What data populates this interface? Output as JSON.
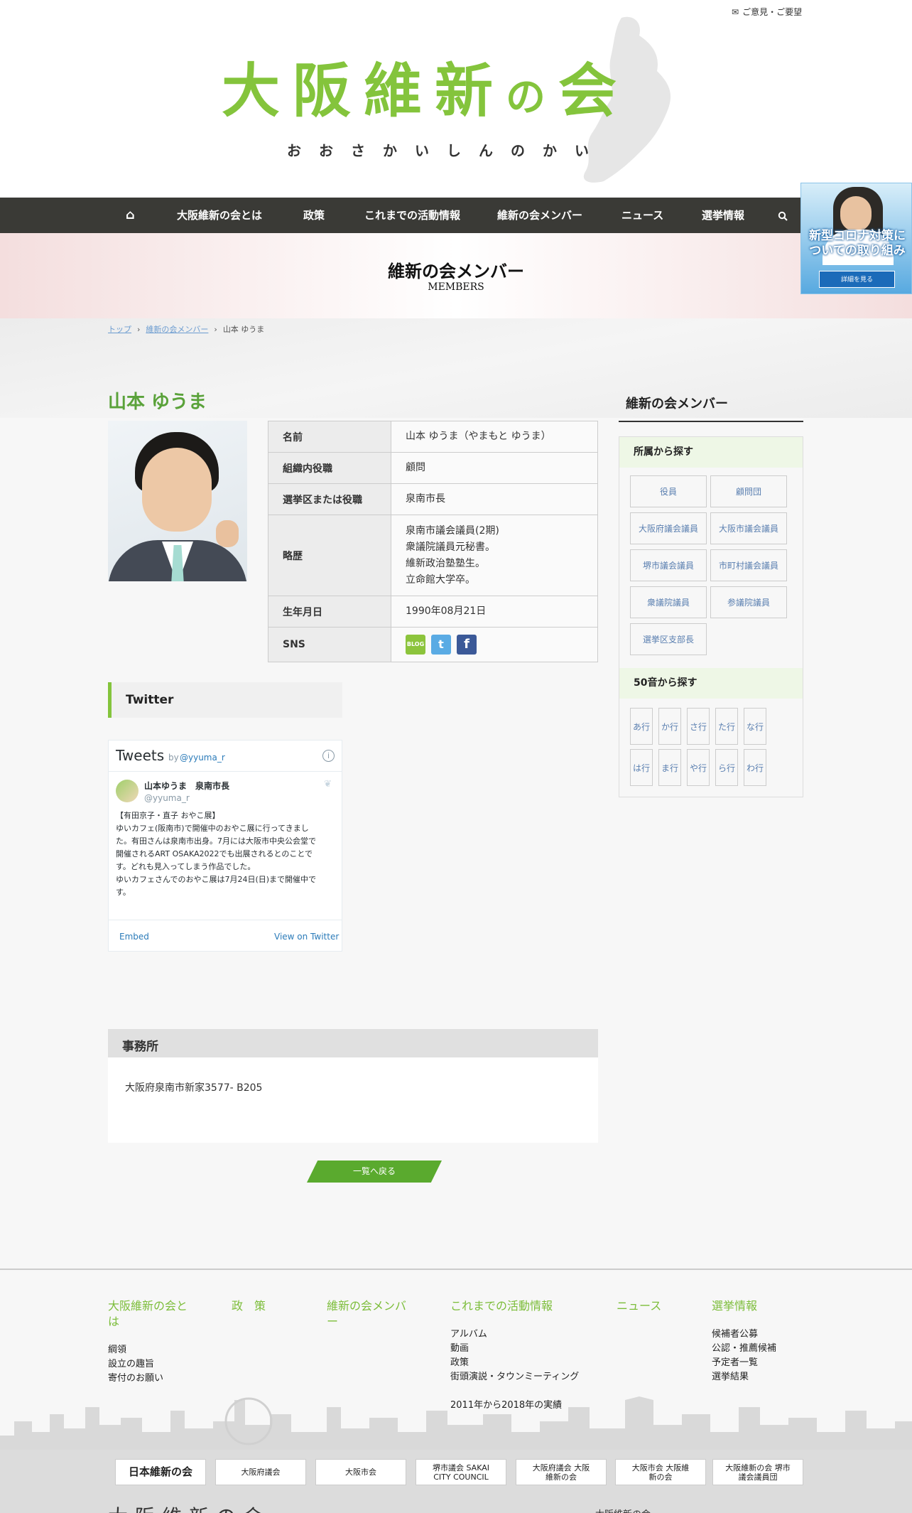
{
  "topbar": {
    "feedback_label": "ご意見・ご要望"
  },
  "logo": {
    "main_a": "大阪維新",
    "main_b": "の",
    "main_c": "会",
    "sub": "おおさかいしんのかい"
  },
  "nav": {
    "items": [
      "大阪維新の会とは",
      "政策",
      "これまでの活動情報",
      "維新の会メンバー",
      "ニュース",
      "選挙情報"
    ]
  },
  "banner": {
    "line1": "新型コロナ対策に",
    "line2": "ついての取り組み",
    "button": "詳細を見る"
  },
  "hero": {
    "title": "維新の会メンバー",
    "subtitle": "MEMBERS"
  },
  "breadcrumb": {
    "home": "トップ",
    "section": "維新の会メンバー",
    "current": "山本 ゆうま"
  },
  "member": {
    "name": "山本 ゆうま",
    "rows": [
      {
        "label": "名前",
        "value": "山本 ゆうま（やまもと ゆうま）"
      },
      {
        "label": "組織内役職",
        "value": "顧問"
      },
      {
        "label": "選挙区または役職",
        "value": "泉南市長"
      }
    ],
    "career_label": "略歴",
    "career": [
      "泉南市議会議員(2期)",
      "衆議院議員元秘書。",
      "維新政治塾塾生。",
      "立命館大学卒。"
    ],
    "birth_label": "生年月日",
    "birth": "1990年08月21日",
    "sns_label": "SNS",
    "sns": {
      "blog": "BLOG",
      "twitter": "t",
      "facebook": "f"
    }
  },
  "twitter": {
    "heading": "Twitter",
    "widget_title": "Tweets",
    "by": "by",
    "handle": "@yyuma_r",
    "author": "山本ゆうま　泉南市長",
    "author_handle": "@yyuma_r",
    "text": [
      "【有田京子・直子 おやこ展】",
      "ゆいカフェ(阪南市)で開催中のおやこ展に行ってきまし",
      "た。有田さんは泉南市出身。7月には大阪市中央公会堂で",
      "開催されるART OSAKA2022でも出展されるとのことで",
      "す。どれも見入ってしまう作品でした。",
      "ゆいカフェさんでのおやこ展は7月24日(日)まで開催中で",
      "す。"
    ],
    "embed": "Embed",
    "view": "View on Twitter"
  },
  "office": {
    "heading": "事務所",
    "address": "大阪府泉南市新家3577- B205"
  },
  "back_button": "一覧へ戻る",
  "sidebar": {
    "title": "維新の会メンバー",
    "affiliation_title": "所属から探す",
    "affiliations": [
      "役員",
      "顧問団",
      "大阪府議会議員",
      "大阪市議会議員",
      "堺市議会議員",
      "市町村議会議員",
      "衆議院議員",
      "参議院議員",
      "選挙区支部長"
    ],
    "kana_title": "50音から探す",
    "kana": [
      "あ行",
      "か行",
      "さ行",
      "た行",
      "な行",
      "は行",
      "ま行",
      "や行",
      "ら行",
      "わ行"
    ]
  },
  "footer": {
    "cols": [
      {
        "title": "大阪維新の会とは",
        "links": [
          "綱領",
          "設立の趣旨",
          "寄付のお願い"
        ]
      },
      {
        "title": "政　策",
        "links": []
      },
      {
        "title": "維新の会メンバー",
        "links": []
      },
      {
        "title": "これまでの活動情報",
        "links": [
          "アルバム",
          "動画",
          "政策",
          "街頭演説・タウンミーティング",
          "2011年から2018年の実績"
        ]
      },
      {
        "title": "ニュース",
        "links": []
      },
      {
        "title": "選挙情報",
        "links": [
          "候補者公募",
          "公認・推薦候補",
          "予定者一覧",
          "選挙結果"
        ]
      }
    ],
    "partners": [
      "日本維新の会",
      "大阪府議会",
      "大阪市会",
      "堺市議会 SAKAI CITY COUNCIL",
      "大阪府議会 大阪維新の会",
      "大阪市会 大阪維新の会",
      "大阪維新の会 堺市議会議員団"
    ],
    "bottom_logo": "大阪維新の会",
    "bottom_right": "大阪維新の会"
  },
  "colors": {
    "accent": "#84c43c",
    "nav": "#3a3a36",
    "link": "#5a7fb0"
  }
}
